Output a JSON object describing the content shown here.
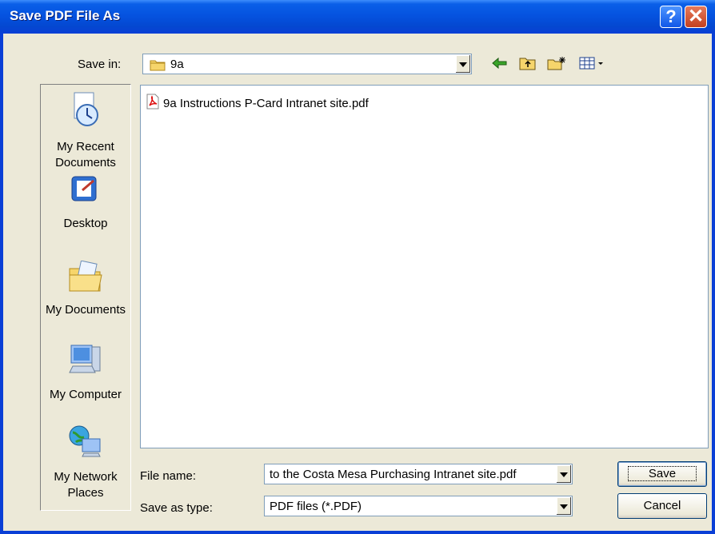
{
  "window": {
    "title": "Save PDF File As",
    "help_glyph": "?",
    "close_glyph": "✕"
  },
  "save_in": {
    "label": "Save in:",
    "value": "9a"
  },
  "places": [
    {
      "label": "My Recent Documents",
      "icon": "recent-documents-icon"
    },
    {
      "label": "Desktop",
      "icon": "desktop-icon"
    },
    {
      "label": "My Documents",
      "icon": "my-documents-icon"
    },
    {
      "label": "My Computer",
      "icon": "my-computer-icon"
    },
    {
      "label": "My Network Places",
      "icon": "network-places-icon"
    }
  ],
  "files": [
    {
      "name": "9a Instructions P-Card Intranet site.pdf",
      "icon": "pdf-file-icon"
    }
  ],
  "file_name": {
    "label": "File name:",
    "value": "to the Costa Mesa Purchasing Intranet site.pdf"
  },
  "save_as_type": {
    "label": "Save as type:",
    "value": "PDF files (*.PDF)"
  },
  "buttons": {
    "save": "Save",
    "cancel": "Cancel"
  }
}
